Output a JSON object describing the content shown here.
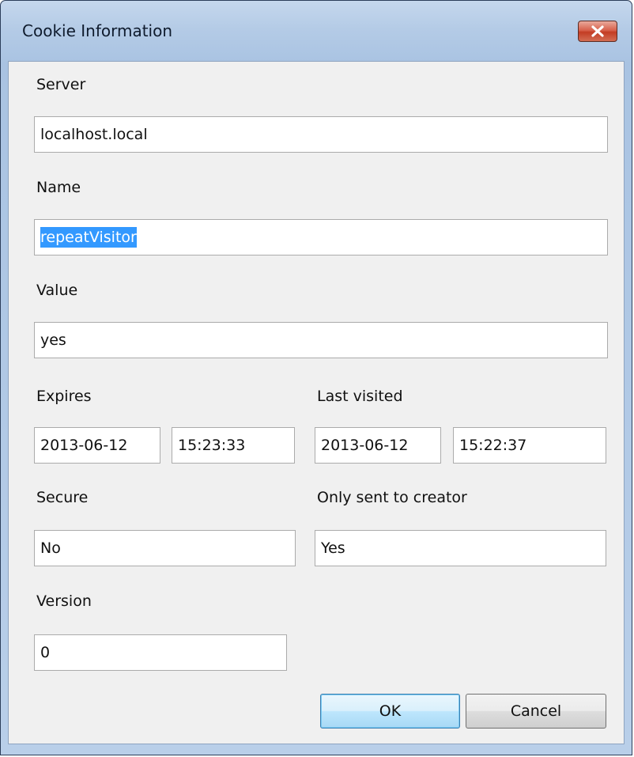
{
  "window": {
    "title": "Cookie Information"
  },
  "fields": {
    "server": {
      "label": "Server",
      "value": "localhost.local"
    },
    "name": {
      "label": "Name",
      "value": "repeatVisitor"
    },
    "value": {
      "label": "Value",
      "value": "yes"
    },
    "expires": {
      "label": "Expires",
      "date": "2013-06-12",
      "time": "15:23:33"
    },
    "last_visited": {
      "label": "Last visited",
      "date": "2013-06-12",
      "time": "15:22:37"
    },
    "secure": {
      "label": "Secure",
      "value": "No"
    },
    "only_sent_to_creator": {
      "label": "Only sent to creator",
      "value": "Yes"
    },
    "version": {
      "label": "Version",
      "value": "0"
    }
  },
  "buttons": {
    "ok_label": "OK",
    "cancel_label": "Cancel"
  },
  "colors": {
    "selection": "#3399ff",
    "close_button": "#c33d24",
    "default_button_border": "#3c7fb1"
  }
}
